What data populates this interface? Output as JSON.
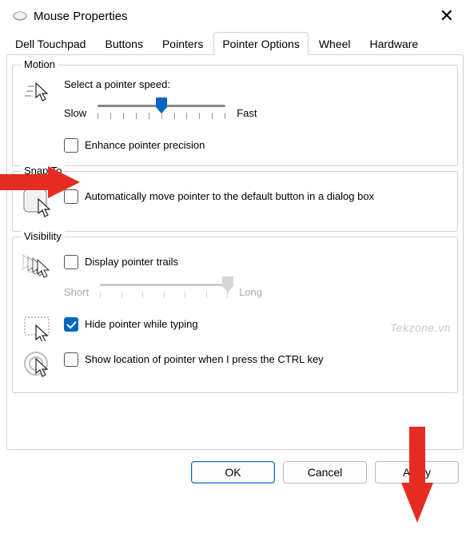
{
  "window": {
    "title": "Mouse Properties"
  },
  "tabs": [
    {
      "label": "Dell Touchpad",
      "active": false
    },
    {
      "label": "Buttons",
      "active": false
    },
    {
      "label": "Pointers",
      "active": false
    },
    {
      "label": "Pointer Options",
      "active": true
    },
    {
      "label": "Wheel",
      "active": false
    },
    {
      "label": "Hardware",
      "active": false
    }
  ],
  "motion": {
    "legend": "Motion",
    "speed_label": "Select a pointer speed:",
    "slow_label": "Slow",
    "fast_label": "Fast",
    "speed_value": 5,
    "speed_ticks": 11,
    "enhance_label": "Enhance pointer precision",
    "enhance_checked": false
  },
  "snap": {
    "legend": "Snap To",
    "snap_label": "Automatically move pointer to the default button in a dialog box",
    "snap_checked": false
  },
  "visibility": {
    "legend": "Visibility",
    "trails_label": "Display pointer trails",
    "trails_checked": false,
    "short_label": "Short",
    "long_label": "Long",
    "trails_value": 6,
    "trails_ticks": 7,
    "hide_label": "Hide pointer while typing",
    "hide_checked": true,
    "show_loc_label": "Show location of pointer when I press the CTRL key",
    "show_loc_checked": false
  },
  "buttons": {
    "ok": "OK",
    "cancel": "Cancel",
    "apply": "Apply"
  },
  "watermark": "Tekzone.vn"
}
